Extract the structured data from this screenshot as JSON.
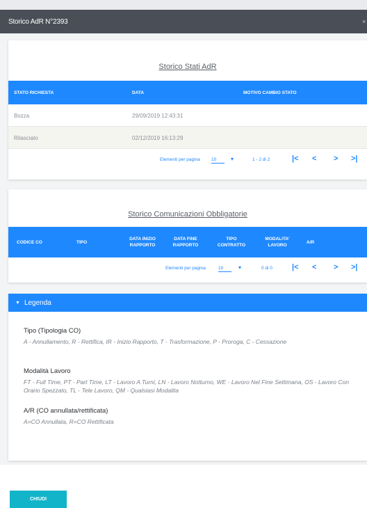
{
  "modal": {
    "title": "Storico AdR N°2393",
    "close": "×"
  },
  "storico_stati": {
    "title": "Storico Stati AdR",
    "columns": [
      "STATO RICHIESTA",
      "DATA",
      "MOTIVO CAMBIO STATO"
    ],
    "rows": [
      {
        "stato": "Bozza",
        "data": "29/09/2019 12:43:31",
        "motivo": ""
      },
      {
        "stato": "Rilasciato",
        "data": "02/12/2019 16:13:29",
        "motivo": ""
      }
    ],
    "pager": {
      "label": "Elementi per pagina",
      "page_size": "10",
      "range": "1 - 2 di 2"
    }
  },
  "storico_co": {
    "title": "Storico Comunicazioni Obbligatorie",
    "columns": {
      "codice": "CODICE CO",
      "tipo": "TIPO",
      "inizio1": "DATA INIZIO",
      "inizio2": "RAPPORTO",
      "fine1": "DATA FINE",
      "fine2": "RAPPORTO",
      "contratto1": "TIPO",
      "contratto2": "CONTRATTO",
      "modalita1": "MODALITA'",
      "modalita2": "LAVORO",
      "ar": "A/R"
    },
    "pager": {
      "label": "Elementi per pagina",
      "page_size": "10",
      "range": "0 di 0"
    }
  },
  "legenda": {
    "title": "Legenda",
    "sections": [
      {
        "title": "Tipo (Tipologia CO)",
        "text": "A - Annullamento, R - Rettifica, IR - Inizio Rapporto, T - Trasformazione, P - Proroga, C - Cessazione"
      },
      {
        "title": "Modalità Lavoro",
        "text": "FT - Full Time, PT - Part Time, LT - Lavoro A Turni, LN - Lavoro Notturno, WE - Lavoro Nel Fine Settimana, OS - Lavoro Con Orario Spezzato, TL - Tele Lavoro, QM - Qualsiasi Modalita"
      },
      {
        "title": "A/R (CO annullata/rettificata)",
        "text": "A=CO Annullata, R=CO Rettificata"
      }
    ]
  },
  "footer": {
    "close_button": "CHIUDI"
  },
  "pager_icons": {
    "first": "|<",
    "prev": "<",
    "next": ">",
    "last": ">|"
  },
  "colors": {
    "primary": "#1e88ff",
    "header": "#4a4f57",
    "button": "#12b4c9"
  }
}
